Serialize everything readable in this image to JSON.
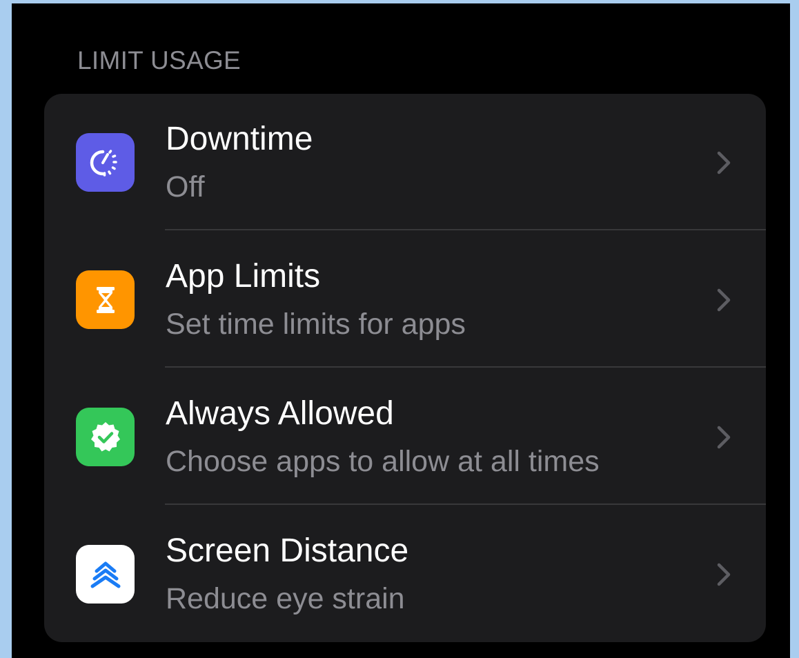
{
  "section": {
    "header": "LIMIT USAGE"
  },
  "rows": [
    {
      "title": "Downtime",
      "subtitle": "Off",
      "icon": "downtime-icon",
      "icon_color": "#5e5ce6"
    },
    {
      "title": "App Limits",
      "subtitle": "Set time limits for apps",
      "icon": "hourglass-icon",
      "icon_color": "#ff9500"
    },
    {
      "title": "Always Allowed",
      "subtitle": "Choose apps to allow at all times",
      "icon": "checkmark-seal-icon",
      "icon_color": "#34c759"
    },
    {
      "title": "Screen Distance",
      "subtitle": "Reduce eye strain",
      "icon": "chevrons-up-icon",
      "icon_color": "#ffffff"
    }
  ],
  "colors": {
    "background": "#000000",
    "card": "#1c1c1e",
    "separator": "#38383a",
    "primary_text": "#ffffff",
    "secondary_text": "#8d8d93",
    "frame": "#a9cdef"
  }
}
